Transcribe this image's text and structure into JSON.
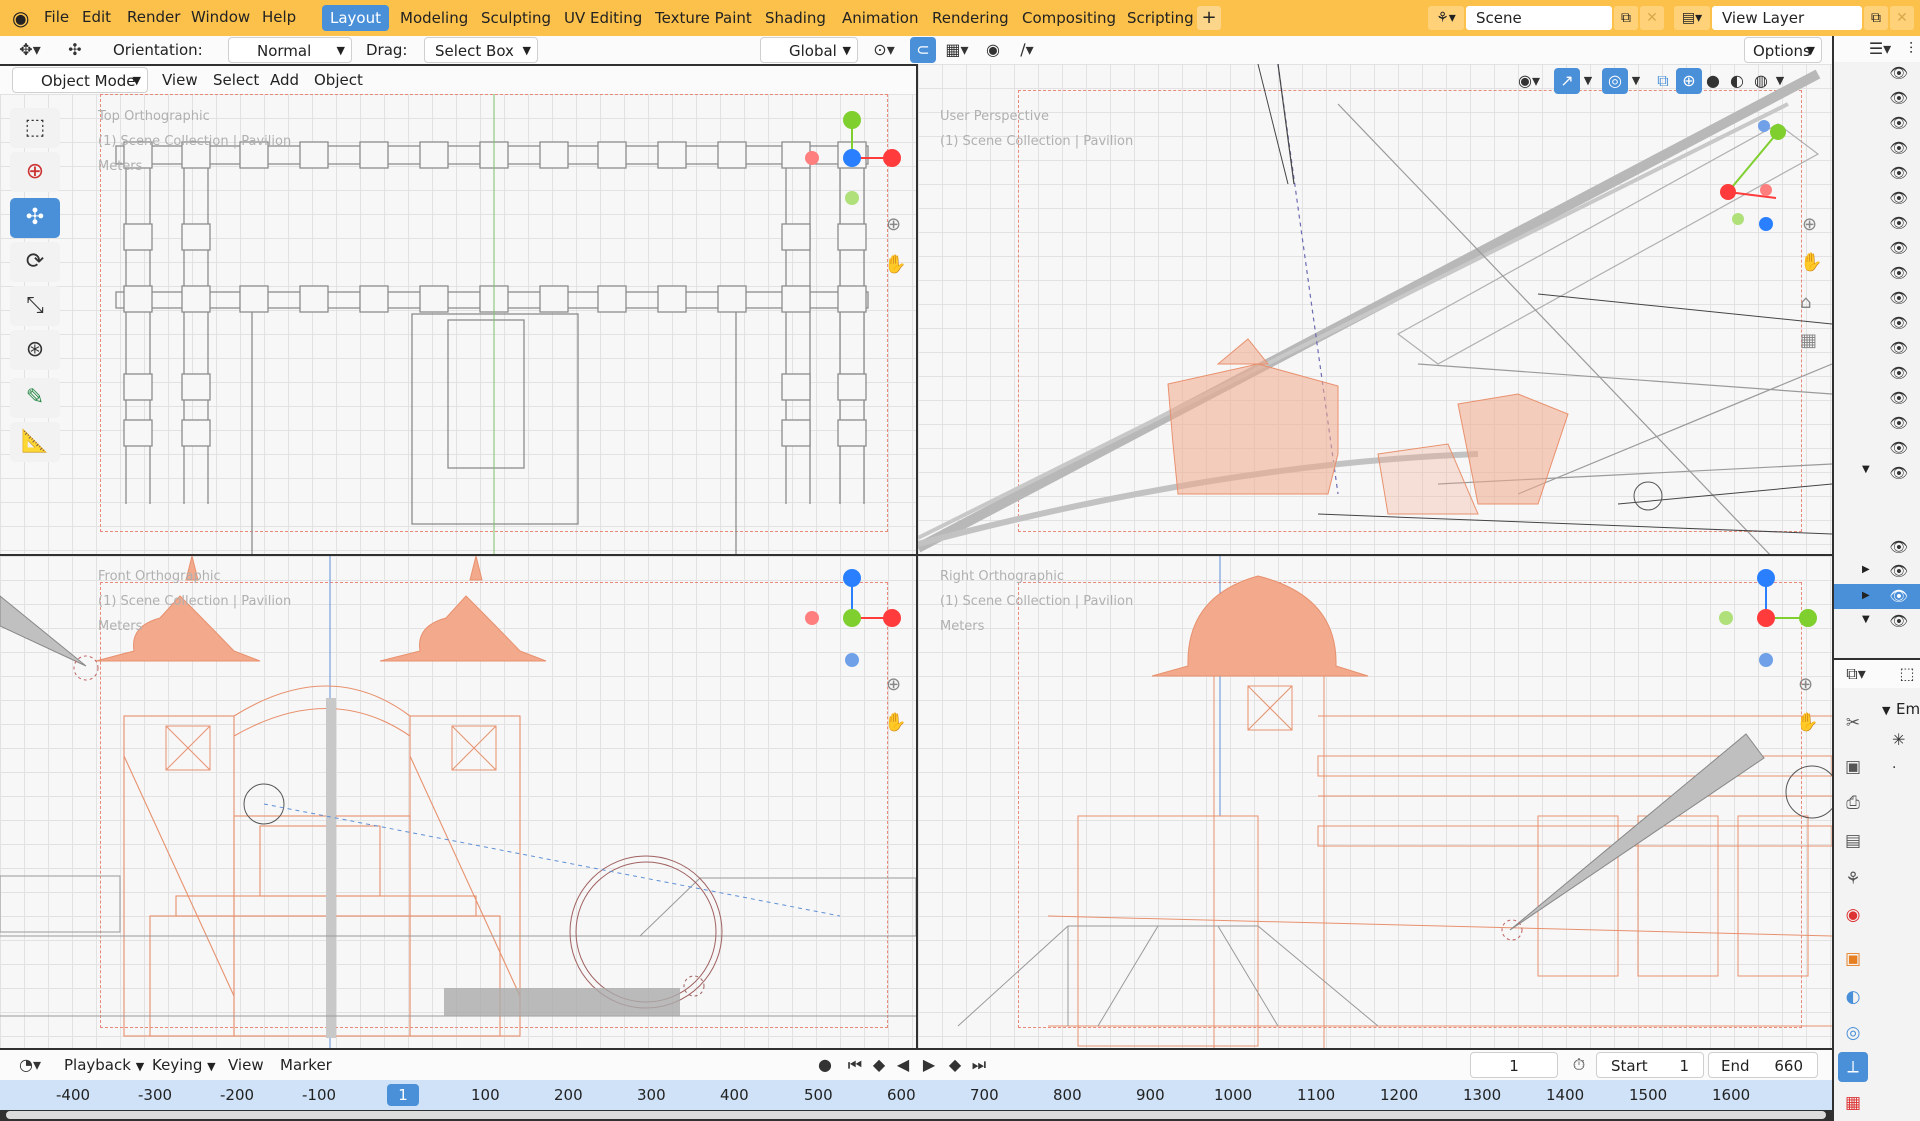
{
  "menus": [
    "File",
    "Edit",
    "Render",
    "Window",
    "Help"
  ],
  "workspaces": [
    {
      "label": "Layout",
      "active": true
    },
    {
      "label": "Modeling"
    },
    {
      "label": "Sculpting"
    },
    {
      "label": "UV Editing"
    },
    {
      "label": "Texture Paint"
    },
    {
      "label": "Shading"
    },
    {
      "label": "Animation"
    },
    {
      "label": "Rendering"
    },
    {
      "label": "Compositing"
    },
    {
      "label": "Scripting"
    }
  ],
  "add_workspace": "+",
  "scene": {
    "value": "Scene"
  },
  "view_layer": {
    "value": "View Layer"
  },
  "tool_header": {
    "orientation_label": "Orientation:",
    "orientation_value": "Normal",
    "drag_label": "Drag:",
    "drag_value": "Select Box",
    "transform_orientation": "Global",
    "options_label": "Options"
  },
  "viewport_header": {
    "mode": "Object Mode",
    "menus": [
      "View",
      "Select",
      "Add",
      "Object"
    ]
  },
  "viewports": [
    {
      "name": "top",
      "title": "Top Orthographic",
      "collection": "(1) Scene Collection | Pavilion",
      "units": "Meters"
    },
    {
      "name": "user",
      "title": "User Perspective",
      "collection": "(1) Scene Collection | Pavilion",
      "units": ""
    },
    {
      "name": "front",
      "title": "Front Orthographic",
      "collection": "(1) Scene Collection | Pavilion",
      "units": "Meters"
    },
    {
      "name": "right",
      "title": "Right Orthographic",
      "collection": "(1) Scene Collection | Pavilion",
      "units": "Meters"
    }
  ],
  "gizmo_axes": {
    "x": "X",
    "y": "Y",
    "z": "Z"
  },
  "tools": [
    "select-box",
    "cursor",
    "move",
    "rotate",
    "scale",
    "transform",
    "annotate",
    "measure"
  ],
  "properties_header": {
    "label": "Em"
  },
  "timeline": {
    "menus": [
      "Playback",
      "Keying",
      "View",
      "Marker"
    ],
    "current_frame": "1",
    "start_label": "Start",
    "start_value": "1",
    "end_label": "End",
    "end_value": "660",
    "ruler": [
      "-400",
      "-300",
      "-200",
      "-100",
      "1",
      "100",
      "200",
      "300",
      "400",
      "500",
      "600",
      "700",
      "800",
      "900",
      "1000",
      "1100",
      "1200",
      "1300",
      "1400",
      "1500",
      "1600"
    ]
  },
  "colors": {
    "accent": "#4a90d9",
    "topbar": "#fbc14b",
    "wire_selected": "#e8916e",
    "axis_x": "#ff3b3b",
    "axis_y": "#7fcf2f",
    "axis_z": "#2a7fff"
  }
}
